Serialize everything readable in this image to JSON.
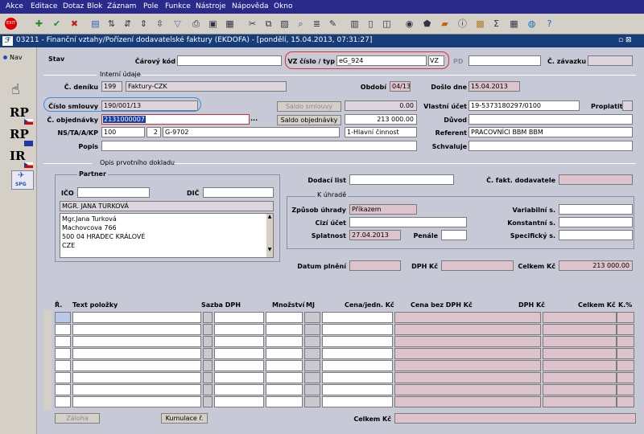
{
  "menu": [
    "Akce",
    "Editace",
    "Dotaz",
    "Blok",
    "Záznam",
    "Pole",
    "Funkce",
    "Nástroje",
    "Nápověda",
    "Okno"
  ],
  "window_title": "03211 - Finanční vztahy/Pořízení dodavatelské faktury (EKDOFA) - [pondělí, 15.04.2013, 07:31:27]",
  "title_controls": "▫ ⊠",
  "nav_label": "Nav",
  "side_buttons": {
    "rp1": "RP",
    "rp2": "RP",
    "ir": "IR",
    "spg": "SPG"
  },
  "header": {
    "stav_label": "Stav",
    "barcode_label": "Čárový kód",
    "vz_label": "VZ číslo / typ",
    "vz_value": "eG_924",
    "vz_type": "VZ",
    "pd_label": "PD",
    "zavazek_label": "Č. závazku"
  },
  "interni": {
    "section": "Interní údaje",
    "denik_label": "Č. deníku",
    "denik_value": "199",
    "denik_name": "Faktury-CZK",
    "obdobi_label": "Období",
    "obdobi_value": "04/13",
    "doslo_label": "Došlo dne",
    "doslo_value": "15.04.2013"
  },
  "smlouva": {
    "label": "Číslo smlouvy",
    "value": "190/001/13",
    "saldo_smlouvy": "Saldo smlouvy",
    "saldo_smlouvy_value": "0.00",
    "vlastni_ucet_label": "Vlastní účet",
    "vlastni_ucet_value": "19-5373180297/0100",
    "proplatit_label": "Proplatit"
  },
  "objednavka": {
    "label": "Č. objednávky",
    "value": "2131000007",
    "ellipsis": "...",
    "saldo_obj": "Saldo objednávky",
    "saldo_obj_value": "213 000.00",
    "duvod_label": "Důvod"
  },
  "nstak": {
    "label": "NS/TA/A/KP",
    "ns": "100",
    "ta": "2",
    "a": "G-9702",
    "kp": "1-Hlavní činnost",
    "referent_label": "Referent",
    "referent_value": "PRACOVNÍCI BBM BBM"
  },
  "popis": {
    "label": "Popis",
    "schvaluje_label": "Schvaluje"
  },
  "opis": {
    "section": "Opis prvotního dokladu",
    "partner_label": "Partner",
    "ico_label": "IČO",
    "dic_label": "DIČ",
    "partner_name": "MGR. JANA TURKOVÁ",
    "address": [
      "Mgr.Jana Turková",
      "Machovcova 766",
      "500 04 HRADEC KRÁLOVÉ",
      "CZE"
    ]
  },
  "right": {
    "dodaci_label": "Dodací list",
    "fakt_dod_label": "Č. fakt. dodavatele",
    "k_uhrade": "K úhradě",
    "zpusob_label": "Způsob úhrady",
    "zpusob_value": "Příkazem",
    "cizi_label": "Cizí účet",
    "splatnost_label": "Splatnost",
    "splatnost_value": "27.04.2013",
    "penale_label": "Penále",
    "variabilni_label": "Variabilní s.",
    "konstantni_label": "Konstantní s.",
    "specificky_label": "Specifický s."
  },
  "totals": {
    "datum_label": "Datum plnění",
    "dph_label": "DPH Kč",
    "celkem_label": "Celkem Kč",
    "celkem_value": "213 000.00"
  },
  "table": {
    "headers": [
      "Ř.",
      "Text položky",
      "Sazba DPH",
      "Množství",
      "MJ",
      "Cena/jedn. Kč",
      "Cena bez DPH Kč",
      "DPH Kč",
      "Celkem Kč",
      "K.%"
    ],
    "rows": 8
  },
  "footer": {
    "zaloha": "Záloha",
    "kumulace": "Kumulace ř.",
    "celkem_label": "Celkem Kč"
  }
}
